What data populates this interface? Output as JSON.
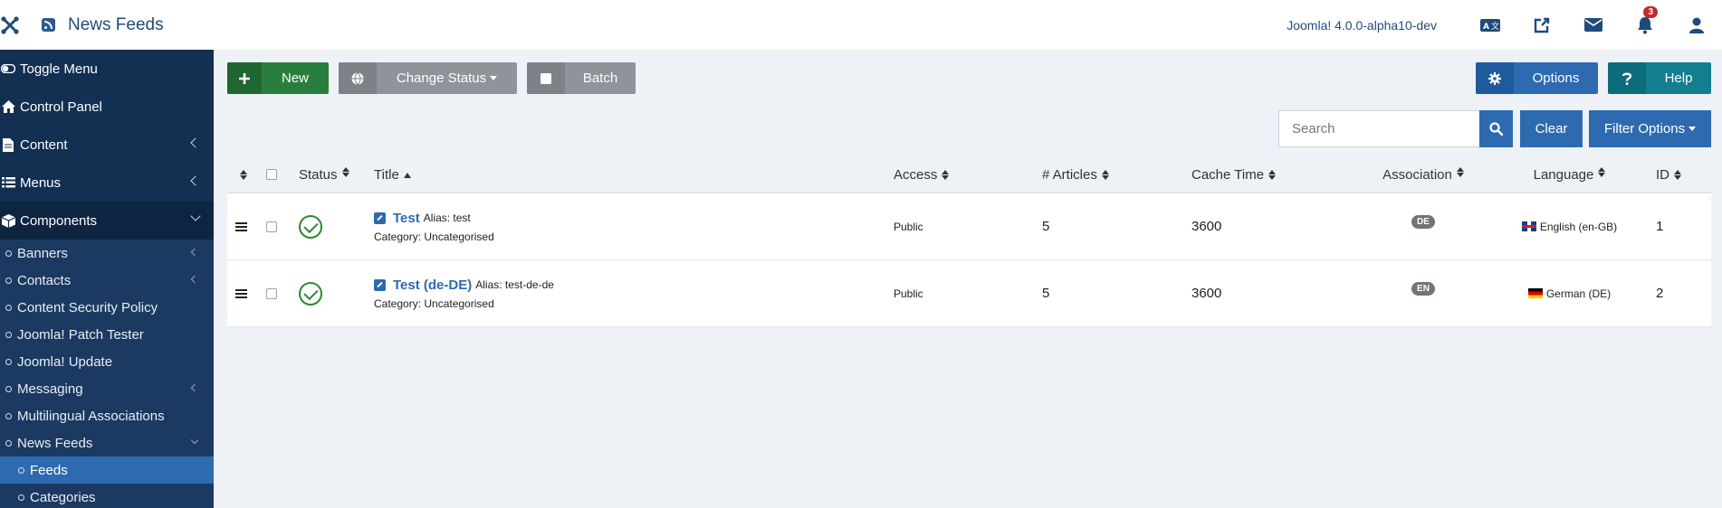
{
  "header": {
    "title": "News Feeds",
    "version": "Joomla! 4.0.0-alpha10-dev",
    "notification_count": "3"
  },
  "sidebar": {
    "top_items": [
      {
        "label": "Toggle Menu"
      },
      {
        "label": "Control Panel"
      },
      {
        "label": "Content"
      },
      {
        "label": "Menus"
      },
      {
        "label": "Components"
      }
    ],
    "sub_items": [
      {
        "label": "Banners"
      },
      {
        "label": "Contacts"
      },
      {
        "label": "Content Security Policy"
      },
      {
        "label": "Joomla! Patch Tester"
      },
      {
        "label": "Joomla! Update"
      },
      {
        "label": "Messaging"
      },
      {
        "label": "Multilingual Associations"
      },
      {
        "label": "News Feeds"
      },
      {
        "label": "Feeds"
      },
      {
        "label": "Categories"
      }
    ]
  },
  "toolbar": {
    "new_label": "New",
    "change_status_label": "Change Status",
    "batch_label": "Batch",
    "options_label": "Options",
    "help_label": "Help"
  },
  "search": {
    "placeholder": "Search",
    "clear_label": "Clear",
    "filter_label": "Filter Options"
  },
  "table": {
    "columns": {
      "status": "Status",
      "title": "Title",
      "access": "Access",
      "articles": "# Articles",
      "cache_time": "Cache Time",
      "association": "Association",
      "language": "Language",
      "id": "ID"
    },
    "rows": [
      {
        "title": "Test",
        "alias": "Alias: test",
        "category": "Category: Uncategorised",
        "access": "Public",
        "articles": "5",
        "cache_time": "3600",
        "association": "DE",
        "language": "English (en-GB)",
        "id": "1"
      },
      {
        "title": "Test (de-DE)",
        "alias": "Alias: test-de-de",
        "category": "Category: Uncategorised",
        "access": "Public",
        "articles": "5",
        "cache_time": "3600",
        "association": "EN",
        "language": "German (DE)",
        "id": "2"
      }
    ]
  }
}
